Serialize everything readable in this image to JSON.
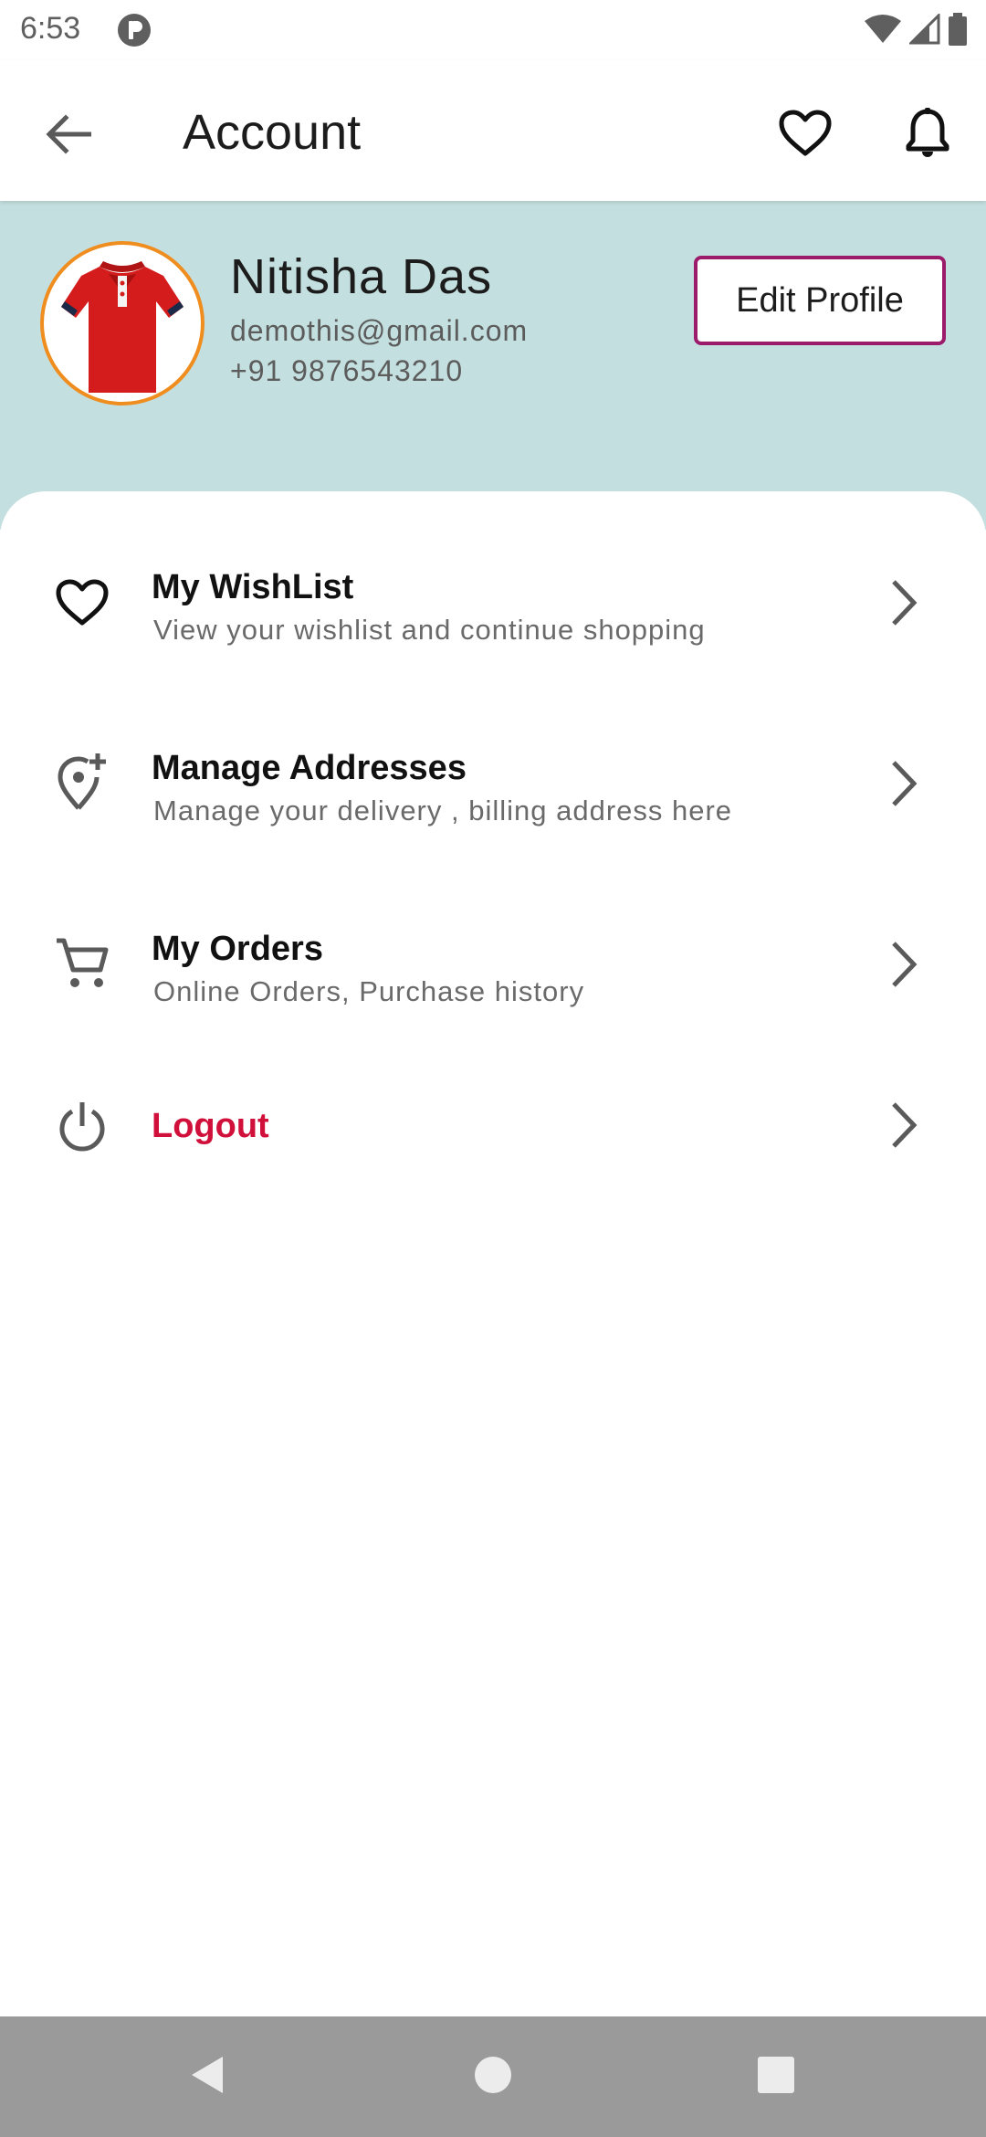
{
  "status_bar": {
    "time": "6:53",
    "icons": [
      "app-notification-icon",
      "wifi-icon",
      "signal-icon",
      "battery-icon"
    ]
  },
  "app_bar": {
    "title": "Account",
    "icons": [
      "back-arrow-icon",
      "heart-icon",
      "bell-icon"
    ]
  },
  "profile": {
    "name": "Nitisha Das",
    "email": "demothis@gmail.com",
    "phone": "+91 9876543210",
    "edit_label": "Edit Profile"
  },
  "menu": [
    {
      "title": "My WishList",
      "subtitle": "View your wishlist and continue shopping",
      "icon": "heart-outline-icon"
    },
    {
      "title": "Manage Addresses",
      "subtitle": "Manage your delivery , billing address here",
      "icon": "add-location-icon"
    },
    {
      "title": "My Orders",
      "subtitle": "Online Orders, Purchase history",
      "icon": "cart-icon"
    },
    {
      "title": "Logout",
      "subtitle": "",
      "icon": "power-icon"
    }
  ],
  "nav_bar": {
    "icons": [
      "nav-back-icon",
      "nav-home-icon",
      "nav-recents-icon"
    ]
  },
  "colors": {
    "header_bg": "#c4dfdf",
    "avatar_ring": "#ef8d1e",
    "edit_border": "#9c1b6b",
    "logout_text": "#d0103a",
    "nav_bar_bg": "#9a9a9a"
  }
}
